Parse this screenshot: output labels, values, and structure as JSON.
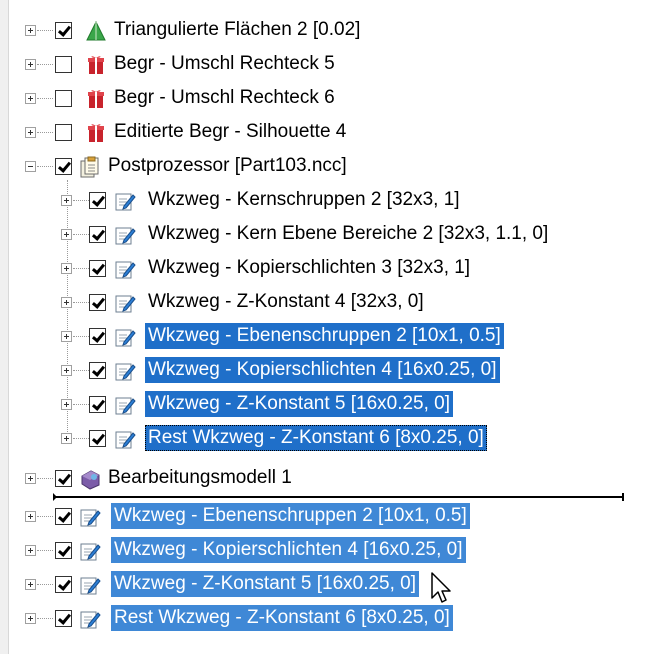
{
  "tree": {
    "rows": [
      {
        "label": "Triangulierte Flächen 2 [0.02]",
        "checked": true,
        "icon": "triangle-surface-icon",
        "selected": "none"
      },
      {
        "label": "Begr - Umschl Rechteck 5",
        "checked": false,
        "icon": "boundary-icon",
        "selected": "none"
      },
      {
        "label": "Begr - Umschl Rechteck 6",
        "checked": false,
        "icon": "boundary-icon",
        "selected": "none"
      },
      {
        "label": "Editierte Begr - Silhouette 4",
        "checked": false,
        "icon": "boundary-icon",
        "selected": "none"
      },
      {
        "label": "Postprozessor [Part103.ncc]",
        "checked": true,
        "icon": "postprocessor-icon",
        "selected": "none",
        "expanded": true
      },
      {
        "label": "Wkzweg - Kernschruppen 2 [32x3, 1]",
        "checked": true,
        "icon": "toolpath-icon",
        "selected": "none"
      },
      {
        "label": "Wkzweg - Kern Ebene Bereiche 2 [32x3, 1.1, 0]",
        "checked": true,
        "icon": "toolpath-icon",
        "selected": "none"
      },
      {
        "label": "Wkzweg - Kopierschlichten 3 [32x3, 1]",
        "checked": true,
        "icon": "toolpath-icon",
        "selected": "none"
      },
      {
        "label": "Wkzweg - Z-Konstant 4 [32x3, 0]",
        "checked": true,
        "icon": "toolpath-icon",
        "selected": "none"
      },
      {
        "label": "Wkzweg - Ebenenschruppen 2 [10x1, 0.5]",
        "checked": true,
        "icon": "toolpath-icon",
        "selected": "dark"
      },
      {
        "label": "Wkzweg - Kopierschlichten 4 [16x0.25, 0]",
        "checked": true,
        "icon": "toolpath-icon",
        "selected": "dark"
      },
      {
        "label": "Wkzweg - Z-Konstant 5 [16x0.25, 0]",
        "checked": true,
        "icon": "toolpath-icon",
        "selected": "dark"
      },
      {
        "label": "Rest Wkzweg - Z-Konstant 6 [8x0.25, 0]",
        "checked": true,
        "icon": "toolpath-icon",
        "selected": "focus"
      },
      {
        "label": "Bearbeitungsmodell 1",
        "checked": true,
        "icon": "stock-model-icon",
        "selected": "none"
      },
      {
        "label": "Wkzweg - Ebenenschruppen 2 [10x1, 0.5]",
        "checked": true,
        "icon": "toolpath-icon",
        "selected": "light"
      },
      {
        "label": "Wkzweg - Kopierschlichten 4 [16x0.25, 0]",
        "checked": true,
        "icon": "toolpath-icon",
        "selected": "light"
      },
      {
        "label": "Wkzweg - Z-Konstant 5 [16x0.25, 0]",
        "checked": true,
        "icon": "toolpath-icon",
        "selected": "light"
      },
      {
        "label": "Rest Wkzweg - Z-Konstant 6 [8x0.25, 0]",
        "checked": true,
        "icon": "toolpath-icon",
        "selected": "light"
      }
    ]
  },
  "colors": {
    "selection": "#1f6fc9",
    "selection_light": "#3f88d6",
    "text": "#000000"
  }
}
